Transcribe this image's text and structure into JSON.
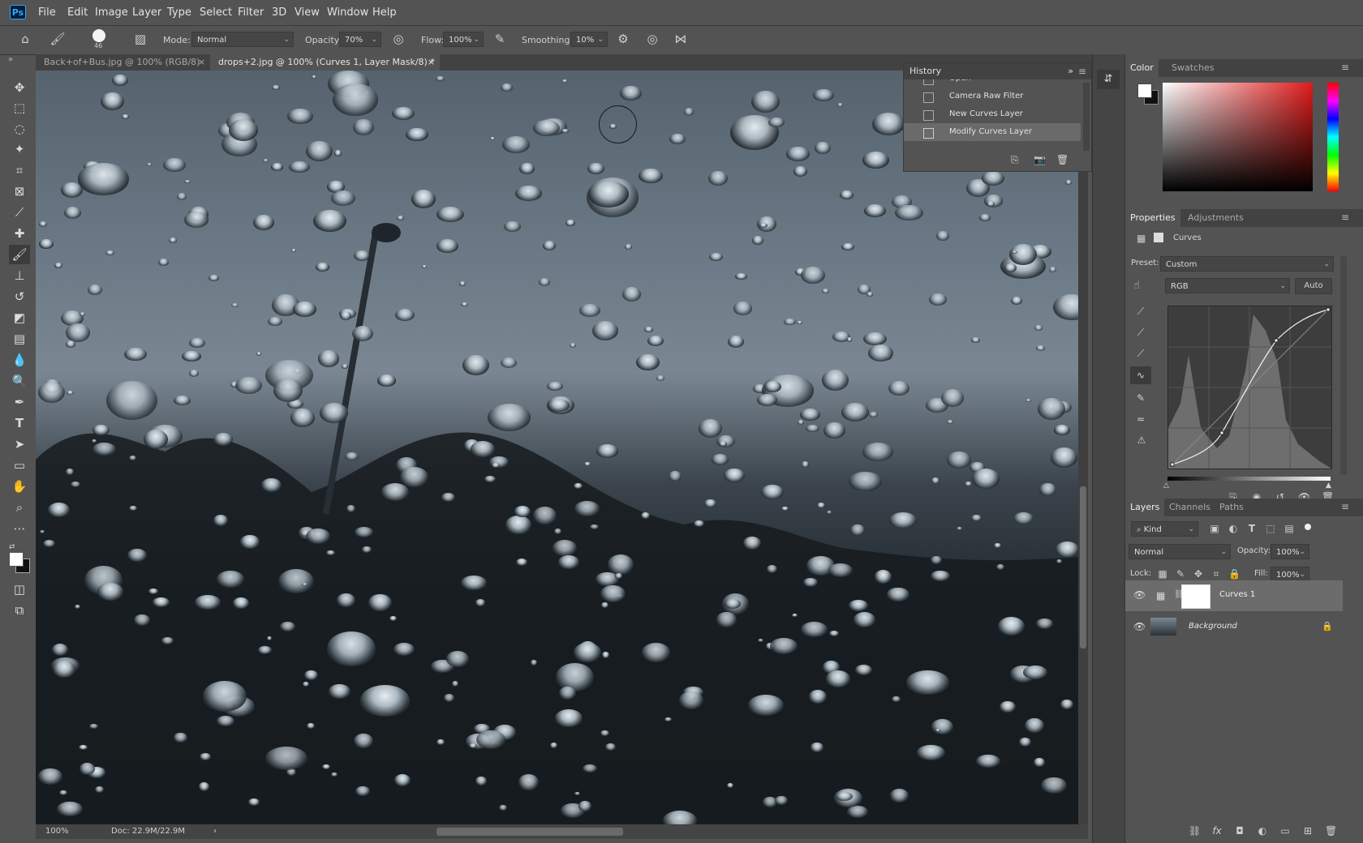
{
  "menubar": {
    "logo": "Ps",
    "items": [
      "File",
      "Edit",
      "Image",
      "Layer",
      "Type",
      "Select",
      "Filter",
      "3D",
      "View",
      "Window",
      "Help"
    ]
  },
  "options": {
    "brush_size": "46",
    "mode_label": "Mode:",
    "mode_value": "Normal",
    "opacity_label": "Opacity:",
    "opacity_value": "70%",
    "flow_label": "Flow:",
    "flow_value": "100%",
    "smoothing_label": "Smoothing:",
    "smoothing_value": "10%"
  },
  "tabs": [
    {
      "label": "Back+of+Bus.jpg @ 100% (RGB/8)",
      "close": "×"
    },
    {
      "label": "drops+2.jpg @ 100% (Curves 1, Layer Mask/8) *",
      "close": "×"
    }
  ],
  "status": {
    "zoom": "100%",
    "doc": "Doc: 22.9M/22.9M",
    "arrow": "›"
  },
  "history": {
    "title": "History",
    "items": [
      "Open",
      "Camera Raw Filter",
      "New Curves Layer",
      "Modify Curves Layer"
    ]
  },
  "color_panel": {
    "tabs": [
      "Color",
      "Swatches"
    ],
    "hue_color": "#e01b1b"
  },
  "properties": {
    "tabs": [
      "Properties",
      "Adjustments"
    ],
    "type_label": "Curves",
    "preset_label": "Preset:",
    "preset_value": "Custom",
    "channel_value": "RGB",
    "auto_label": "Auto"
  },
  "layers_panel": {
    "tabs": [
      "Layers",
      "Channels",
      "Paths"
    ],
    "kind_value": "Kind",
    "blend_value": "Normal",
    "opacity_label": "Opacity:",
    "opacity_value": "100%",
    "lock_label": "Lock:",
    "fill_label": "Fill:",
    "fill_value": "100%",
    "layers": [
      {
        "name": "Curves 1",
        "selected": true
      },
      {
        "name": "Background",
        "locked": true
      }
    ]
  }
}
